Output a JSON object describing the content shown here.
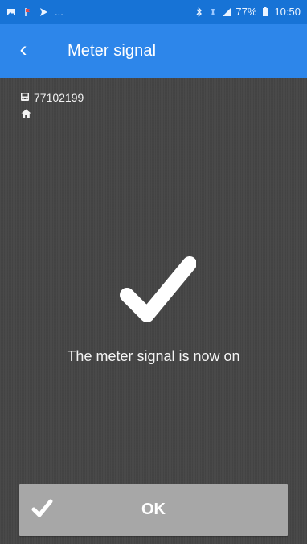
{
  "status": {
    "left_icons": [
      "image-icon",
      "flag-icon",
      "send-icon"
    ],
    "more": "...",
    "battery": "77%",
    "time": "10:50"
  },
  "app_bar": {
    "title": "Meter signal",
    "back_icon": "chevron-left-icon"
  },
  "meter": {
    "id": "77102199",
    "icon": "meter-icon",
    "home_icon": "home-icon"
  },
  "result": {
    "icon": "checkmark-icon",
    "message": "The meter signal is now on"
  },
  "ok_button": {
    "icon": "checkmark-icon",
    "label": "OK"
  },
  "colors": {
    "status_bar": "#1773d6",
    "app_bar": "#2d86ea",
    "background": "#454545",
    "button": "#a7a7a7",
    "text": "#ffffff"
  }
}
